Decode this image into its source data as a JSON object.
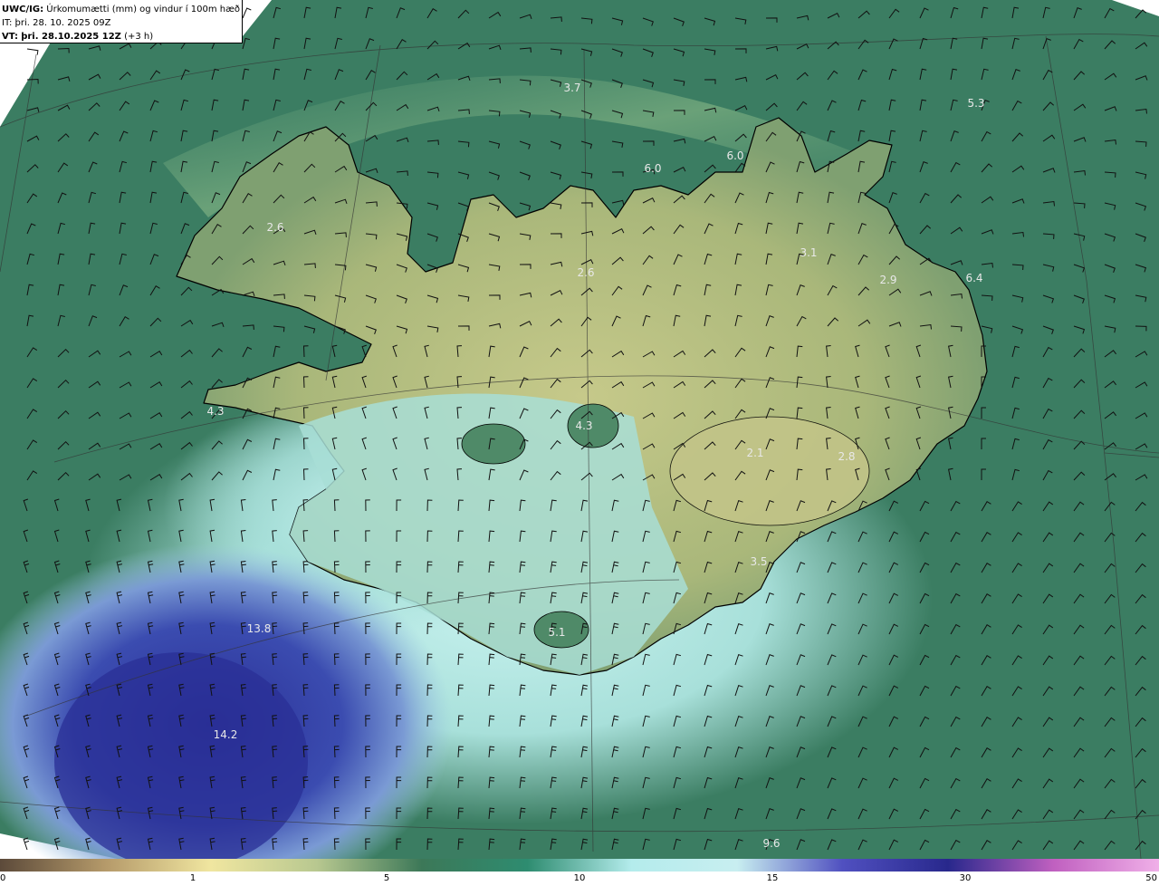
{
  "header": {
    "model_label": "UWC/IG:",
    "parameter": "Úrkomumætti (mm) og vindur í 100m hæð",
    "it_label": "IT:",
    "it_value": "þri. 28. 10. 2025 09Z",
    "vt_label": "VT:",
    "vt_value": "þri. 28.10.2025 12Z",
    "lead_time": "(+3 h)"
  },
  "colorbar": {
    "ticks": [
      "0",
      "1",
      "5",
      "10",
      "15",
      "30",
      "50"
    ],
    "colors": [
      "#5c4a3a",
      "#b59a6a",
      "#f0e6a0",
      "#b8c890",
      "#3c7858",
      "#2e8c70",
      "#b4ecec",
      "#c8eef0",
      "#5050c0",
      "#28288c",
      "#c060c0",
      "#f0b0e8"
    ]
  },
  "map": {
    "colors": {
      "sea_green": "#3b7d62",
      "land_yellow": "#b8bf7e",
      "cyan_zone": "#aee3e0",
      "blue_zone": "#3a4fb0",
      "deep_blue": "#2a2f95",
      "coastline": "#000000",
      "barb": "#111111"
    },
    "value_labels": [
      "3.7",
      "5.3",
      "6.0",
      "6.0",
      "2.6",
      "3.1",
      "2.9",
      "6.4",
      "2.6",
      "4.3",
      "4.3",
      "2.1",
      "2.8",
      "3.5",
      "5.1",
      "13.8",
      "14.2",
      "9.6"
    ]
  }
}
